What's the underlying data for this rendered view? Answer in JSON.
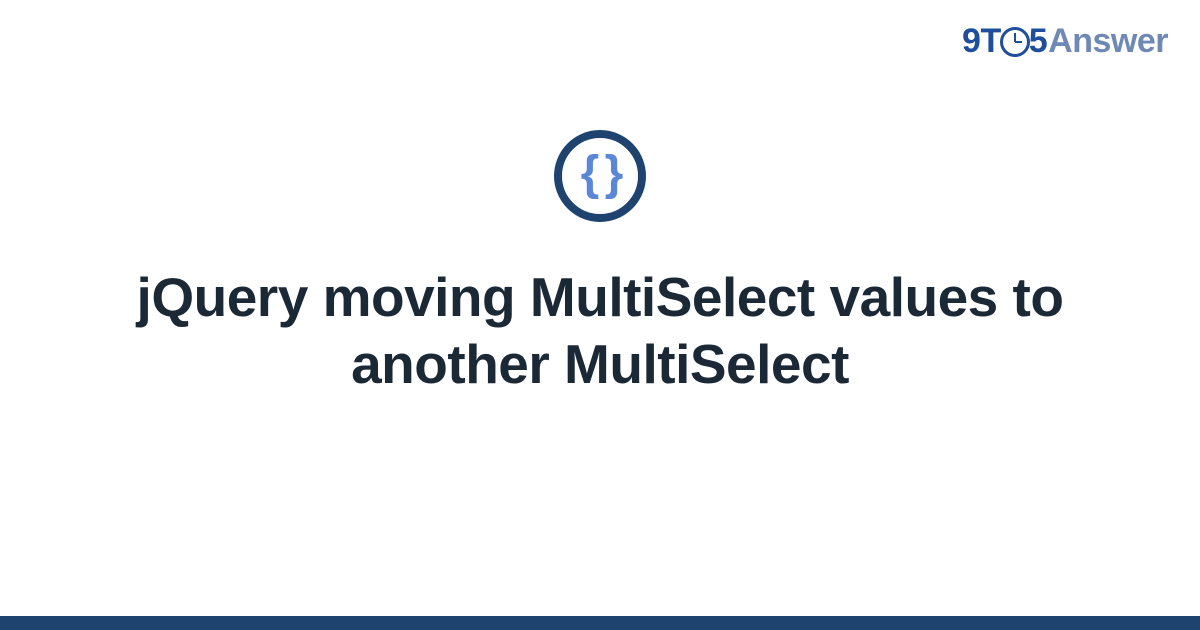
{
  "brand": {
    "nine": "9",
    "t": "T",
    "five": "5",
    "answer": "Answer"
  },
  "icon": {
    "name": "code-braces-icon",
    "glyph": "{ }"
  },
  "title": "jQuery moving MultiSelect values to another MultiSelect",
  "colors": {
    "brand_primary": "#1f4e9c",
    "brand_secondary": "#6f89b5",
    "icon_ring": "#1e436f",
    "icon_glyph": "#5b88d6",
    "title_text": "#1b2836",
    "footer_bar": "#1e436f"
  }
}
